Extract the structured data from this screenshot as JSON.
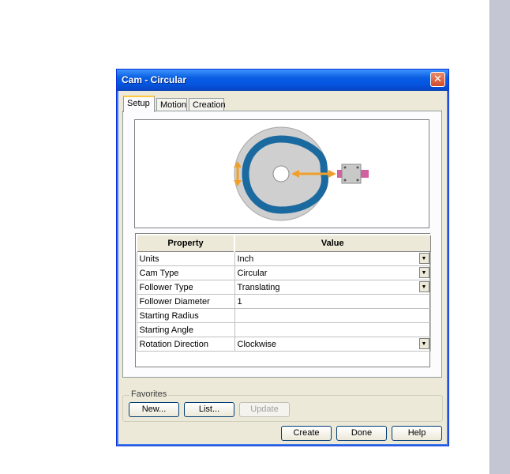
{
  "window": {
    "title": "Cam - Circular",
    "close_glyph": "✕"
  },
  "tabs": [
    {
      "label": "Setup",
      "active": true
    },
    {
      "label": "Motion",
      "active": false
    },
    {
      "label": "Creation",
      "active": false
    }
  ],
  "preview": {
    "icon": "cam-follower-diagram",
    "colors": {
      "disk": "#cfcfcf",
      "track": "#1a6aa0",
      "arrow": "#f0a028",
      "follower": "#d060a0",
      "block": "#c8c8c8"
    }
  },
  "grid": {
    "headers": [
      "Property",
      "Value"
    ],
    "rows": [
      {
        "property": "Units",
        "value": "Inch",
        "dropdown": true
      },
      {
        "property": "Cam Type",
        "value": "Circular",
        "dropdown": true
      },
      {
        "property": "Follower Type",
        "value": "Translating",
        "dropdown": true
      },
      {
        "property": "Follower Diameter",
        "value": "1",
        "dropdown": false
      },
      {
        "property": "Starting Radius",
        "value": "",
        "dropdown": false
      },
      {
        "property": "Starting Angle",
        "value": "",
        "dropdown": false
      },
      {
        "property": "Rotation Direction",
        "value": "Clockwise",
        "dropdown": true
      }
    ]
  },
  "favorites": {
    "label": "Favorites",
    "new_label": "New...",
    "list_label": "List...",
    "update_label": "Update"
  },
  "actions": {
    "create_label": "Create",
    "done_label": "Done",
    "help_label": "Help"
  }
}
